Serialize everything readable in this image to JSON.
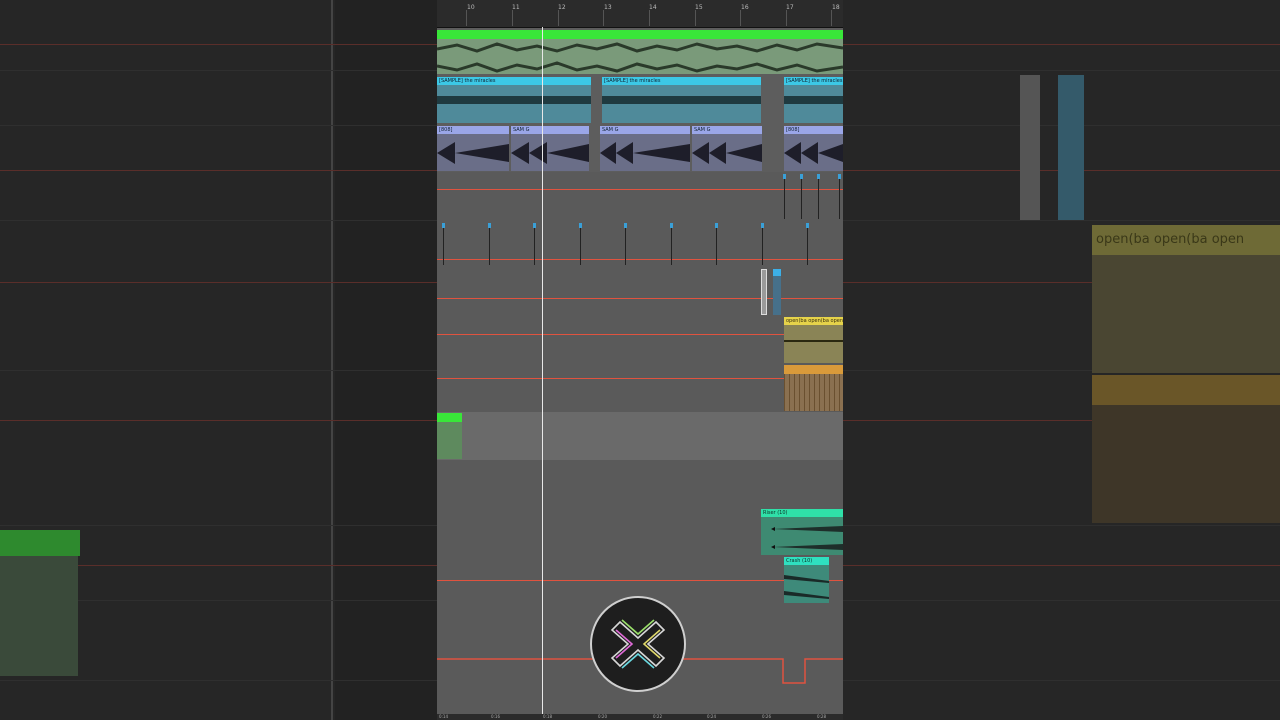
{
  "colors": {
    "master_green": "#39e639",
    "sample_cyan": "#3cc8e6",
    "drum_lavender": "#9aa6e8",
    "yellow_clip": "#e6d34a",
    "orange_clip": "#d99a3a",
    "teal_clip": "#2fe0a8",
    "automation_red": "#e0533f"
  },
  "ruler": {
    "bars": [
      "10",
      "11",
      "12",
      "13",
      "14",
      "15",
      "16",
      "17",
      "18"
    ]
  },
  "clips": {
    "sample_clip_1": "[SAMPLE] the miracles",
    "sample_clip_2": "[SAMPLE] the miracles",
    "sample_clip_3": "[SAMPLE] the miracles",
    "drum_clip_labels": [
      "[808]",
      "[808]",
      "SAM G",
      "[808]",
      "[808]",
      "SAM G",
      "[808]",
      "[808]",
      "[808]",
      "SAM G",
      "[808]",
      "[808]",
      "[808]",
      "SAM G",
      "[808]",
      "[808]",
      "[808]"
    ],
    "yellow_clip": "open(ba open(ba open",
    "riser_clip": "Riser (10)",
    "crash_clip": "Crash (10)"
  },
  "background": {
    "yellow_clip_text": "open(ba open(ba open"
  },
  "timeline": {
    "labels": [
      "0:14",
      "0:16",
      "0:18",
      "0:20",
      "0:22",
      "0:24",
      "0:26",
      "0:28"
    ]
  },
  "logo": {
    "icon": "x-logo-icon"
  }
}
